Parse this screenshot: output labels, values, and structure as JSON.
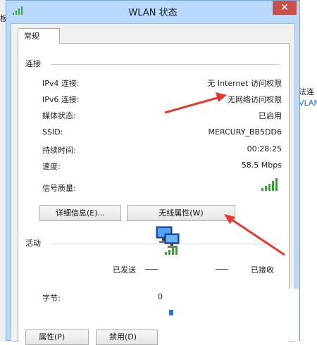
{
  "window": {
    "title": "WLAN 状态",
    "close_glyph": "✕"
  },
  "background": {
    "left_fragment": "板",
    "right_fragments": [
      "法连",
      "VLAN"
    ]
  },
  "tabs": [
    {
      "label": "常规"
    }
  ],
  "connection": {
    "heading": "连接",
    "rows": [
      {
        "label": "IPv4 连接:",
        "value": "无 Internet 访问权限"
      },
      {
        "label": "IPv6 连接:",
        "value": "无网络访问权限"
      },
      {
        "label": "媒体状态:",
        "value": "已启用"
      },
      {
        "label": "SSID:",
        "value": "MERCURY_BB5DD6"
      },
      {
        "label": "持续时间:",
        "value": "00:28:25"
      },
      {
        "label": "速度:",
        "value": "58.5 Mbps"
      },
      {
        "label": "信号质量:",
        "value": ""
      }
    ],
    "signal_icon": "signal-strength-icon",
    "signal_bars": 5
  },
  "buttons": {
    "details": "详细信息(E)...",
    "wireless_properties": "无线属性(W)"
  },
  "activity": {
    "heading": "活动",
    "sent_label": "已发送",
    "received_label": "已接收",
    "bytes_label": "字节:",
    "bytes_sent": "0"
  },
  "bottom_buttons": {
    "properties": "属性(P)",
    "disable": "禁用(D)"
  },
  "colors": {
    "accent": "#b9d9ff",
    "arrow": "#e53a2f",
    "signal": "#3aa335"
  }
}
